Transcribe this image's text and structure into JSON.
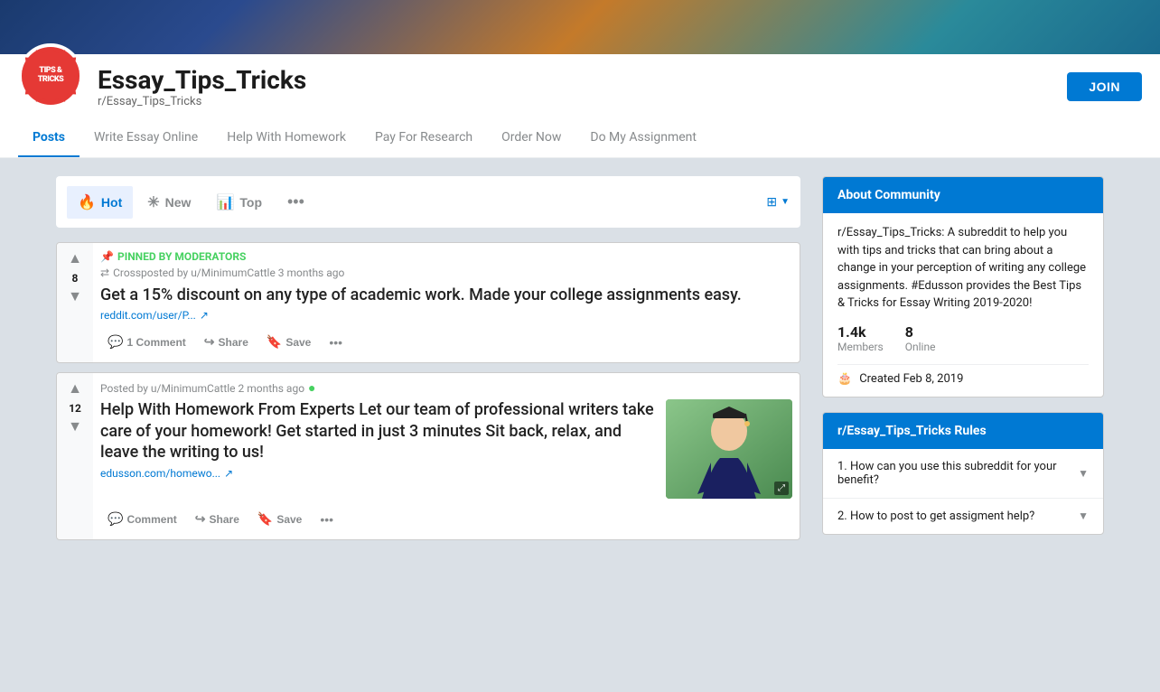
{
  "header": {
    "banner_gradient": "linear-gradient(135deg, #1a3a6e, #c47a2a, #2a8a9a)",
    "logo_line1": "TIPS &",
    "logo_line2": "TRICKS",
    "community_name": "Essay_Tips_Tricks",
    "subreddit": "r/Essay_Tips_Tricks",
    "join_label": "JOIN"
  },
  "nav": {
    "tabs": [
      {
        "label": "Posts",
        "active": true
      },
      {
        "label": "Write Essay Online",
        "active": false
      },
      {
        "label": "Help With Homework",
        "active": false
      },
      {
        "label": "Pay For Research",
        "active": false
      },
      {
        "label": "Order Now",
        "active": false
      },
      {
        "label": "Do My Assignment",
        "active": false
      }
    ]
  },
  "sort_bar": {
    "hot_label": "Hot",
    "new_label": "New",
    "top_label": "Top",
    "more_label": "•••"
  },
  "posts": [
    {
      "id": "post1",
      "vote_count": "8",
      "pinned": true,
      "pinned_label": "PINNED BY MODERATORS",
      "crosspost": "Crossposted by u/MinimumCattle 3 months ago",
      "title": "Get a 15% discount on any type of academic work. Made your college assignments easy.",
      "link": "reddit.com/user/P...",
      "comment_label": "1 Comment",
      "share_label": "Share",
      "save_label": "Save",
      "has_thumbnail": false
    },
    {
      "id": "post2",
      "vote_count": "12",
      "pinned": false,
      "posted_by": "Posted by u/MinimumCattle 2 months ago",
      "title": "Help With Homework From Experts Let our team of professional writers take care of your homework! Get started in just 3 minutes Sit back, relax, and leave the writing to us!",
      "link": "edusson.com/homewo...",
      "comment_label": "Comment",
      "share_label": "Share",
      "save_label": "Save",
      "has_thumbnail": true
    }
  ],
  "sidebar": {
    "about_header": "About Community",
    "about_text": "r/Essay_Tips_Tricks: A subreddit to help you with tips and tricks that can bring about a change in your perception of writing any college assignments. #Edusson provides the Best Tips & Tricks for Essay Writing 2019-2020!",
    "members_count": "1.4k",
    "members_label": "Members",
    "online_count": "8",
    "online_label": "Online",
    "created_label": "Created Feb 8, 2019",
    "rules_header": "r/Essay_Tips_Tricks Rules",
    "rules": [
      {
        "label": "1. How can you use this subreddit for your benefit?"
      },
      {
        "label": "2. How to post to get assigment help?"
      }
    ]
  }
}
